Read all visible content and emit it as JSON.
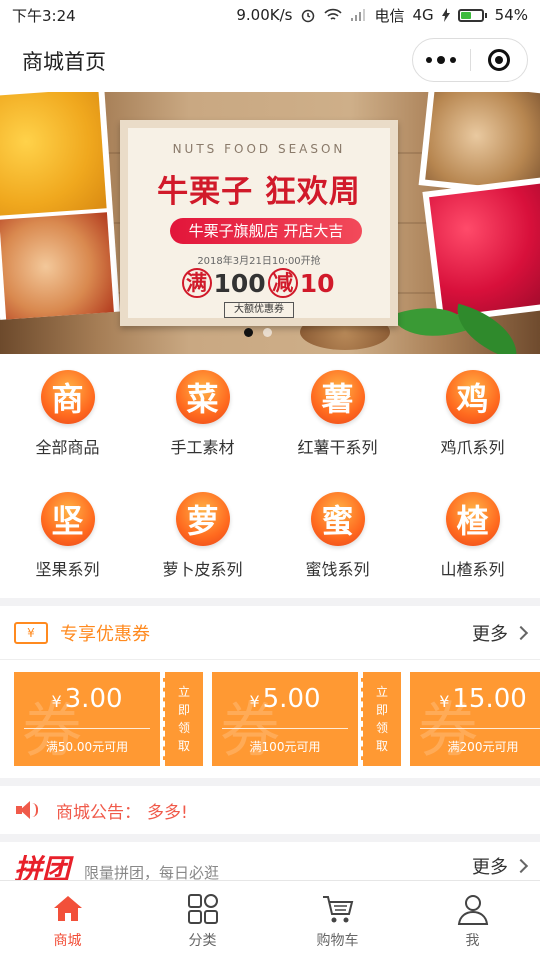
{
  "status_bar": {
    "time": "下午3:24",
    "speed": "9.00K/s",
    "carrier": "电信",
    "network": "4G",
    "battery": "54%"
  },
  "navbar": {
    "title": "商城首页"
  },
  "banner": {
    "en_text": "NUTS FOOD SEASON",
    "title": "牛栗子 狂欢周",
    "pill": "牛栗子旗舰店 开店大吉",
    "date": "2018年3月21日10:00开抢",
    "promo": {
      "man": "满",
      "num1": "100",
      "jian": "减",
      "num2": "10"
    },
    "badge": "大额优惠券",
    "pages": 2,
    "active_page": 0
  },
  "categories": [
    {
      "icon_char": "商",
      "label": "全部商品"
    },
    {
      "icon_char": "菜",
      "label": "手工素材"
    },
    {
      "icon_char": "薯",
      "label": "红薯干系列"
    },
    {
      "icon_char": "鸡",
      "label": "鸡爪系列"
    },
    {
      "icon_char": "坚",
      "label": "坚果系列"
    },
    {
      "icon_char": "萝",
      "label": "萝卜皮系列"
    },
    {
      "icon_char": "蜜",
      "label": "蜜饯系列"
    },
    {
      "icon_char": "楂",
      "label": "山楂系列"
    }
  ],
  "coupon_section": {
    "icon_text": "¥",
    "title": "专享优惠券",
    "more": "更多"
  },
  "coupons": [
    {
      "symbol": "¥",
      "amount": "3.00",
      "condition": "满50.00元可用",
      "watermark": "券",
      "action": [
        "立",
        "即",
        "领",
        "取"
      ]
    },
    {
      "symbol": "¥",
      "amount": "5.00",
      "condition": "满100元可用",
      "watermark": "券",
      "action": [
        "立",
        "即",
        "领",
        "取"
      ]
    },
    {
      "symbol": "¥",
      "amount": "15.00",
      "condition": "满200元可用",
      "watermark": "券",
      "action": [
        "立",
        "即",
        "领",
        "取"
      ]
    }
  ],
  "notice": {
    "label": "商城公告：",
    "text": "多多!"
  },
  "group_buy": {
    "title": "拼团",
    "subtitle": "限量拼团，每日必逛",
    "more": "更多"
  },
  "tabbar": [
    {
      "label": "商城",
      "icon": "home-icon",
      "active": true
    },
    {
      "label": "分类",
      "icon": "category-icon",
      "active": false
    },
    {
      "label": "购物车",
      "icon": "cart-icon",
      "active": false
    },
    {
      "label": "我",
      "icon": "user-icon",
      "active": false
    }
  ],
  "colors": {
    "accent": "#f2503a",
    "coupon": "#ff9933",
    "coupon_title": "#ff8a1f"
  }
}
